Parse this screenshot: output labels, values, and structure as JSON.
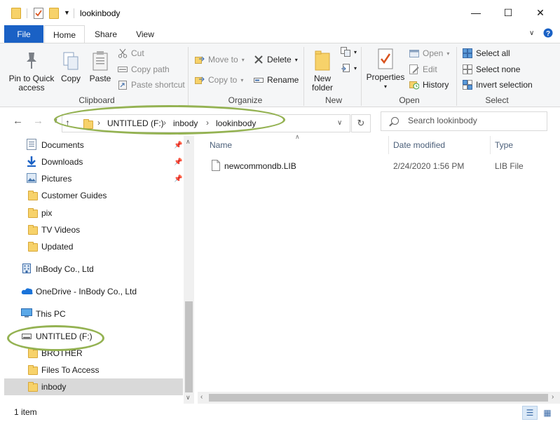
{
  "window": {
    "title": "lookinbody",
    "minimize": "—",
    "maximize": "☐",
    "close": "✕"
  },
  "ribbon_tabs": {
    "file": "File",
    "home": "Home",
    "share": "Share",
    "view": "View"
  },
  "ribbon": {
    "clipboard": {
      "label": "Clipboard",
      "pin": "Pin to Quick access",
      "pin_line1": "Pin to Quick",
      "pin_line2": "access",
      "copy": "Copy",
      "paste": "Paste",
      "cut": "Cut",
      "copy_path": "Copy path",
      "paste_shortcut": "Paste shortcut"
    },
    "organize": {
      "label": "Organize",
      "move_to": "Move to",
      "copy_to": "Copy to",
      "delete": "Delete",
      "rename": "Rename"
    },
    "new": {
      "label": "New",
      "new_folder_line1": "New",
      "new_folder_line2": "folder"
    },
    "open": {
      "label": "Open",
      "properties": "Properties",
      "open": "Open",
      "edit": "Edit",
      "history": "History"
    },
    "select": {
      "label": "Select",
      "select_all": "Select all",
      "select_none": "Select none",
      "invert_selection": "Invert selection"
    }
  },
  "address": {
    "crumbs": [
      "UNTITLED (F:)",
      "inbody",
      "lookinbody"
    ],
    "search_placeholder": "Search lookinbody"
  },
  "nav": {
    "items": [
      {
        "label": "Documents",
        "icon": "documents-icon",
        "pinned": true
      },
      {
        "label": "Downloads",
        "icon": "downloads-icon",
        "pinned": true
      },
      {
        "label": "Pictures",
        "icon": "pictures-icon",
        "pinned": true
      },
      {
        "label": "Customer Guides",
        "icon": "folder-icon",
        "pinned": false
      },
      {
        "label": "pix",
        "icon": "folder-icon",
        "pinned": false
      },
      {
        "label": "TV Videos",
        "icon": "folder-icon",
        "pinned": false
      },
      {
        "label": "Updated",
        "icon": "folder-icon",
        "pinned": false
      },
      {
        "label": "InBody Co., Ltd",
        "icon": "building-icon",
        "pinned": false
      },
      {
        "label": "OneDrive - InBody Co., Ltd",
        "icon": "onedrive-icon",
        "pinned": false
      },
      {
        "label": "This PC",
        "icon": "computer-icon",
        "pinned": false
      },
      {
        "label": "UNTITLED (F:)",
        "icon": "drive-icon",
        "pinned": false
      },
      {
        "label": "BROTHER",
        "icon": "folder-icon",
        "pinned": false
      },
      {
        "label": "Files To Access",
        "icon": "folder-icon",
        "pinned": false
      },
      {
        "label": "inbody",
        "icon": "folder-icon",
        "pinned": false,
        "selected": true
      }
    ]
  },
  "content": {
    "columns": {
      "name": "Name",
      "date": "Date modified",
      "type": "Type"
    },
    "files": [
      {
        "name": "newcommondb.LIB",
        "date": "2/24/2020 1:56 PM",
        "type": "LIB File"
      }
    ]
  },
  "status": {
    "count": "1 item"
  },
  "colors": {
    "file_tab": "#1a61c5",
    "annotation": "#94b252",
    "folder": "#f7d26a",
    "selected": "#d9d9d9"
  }
}
